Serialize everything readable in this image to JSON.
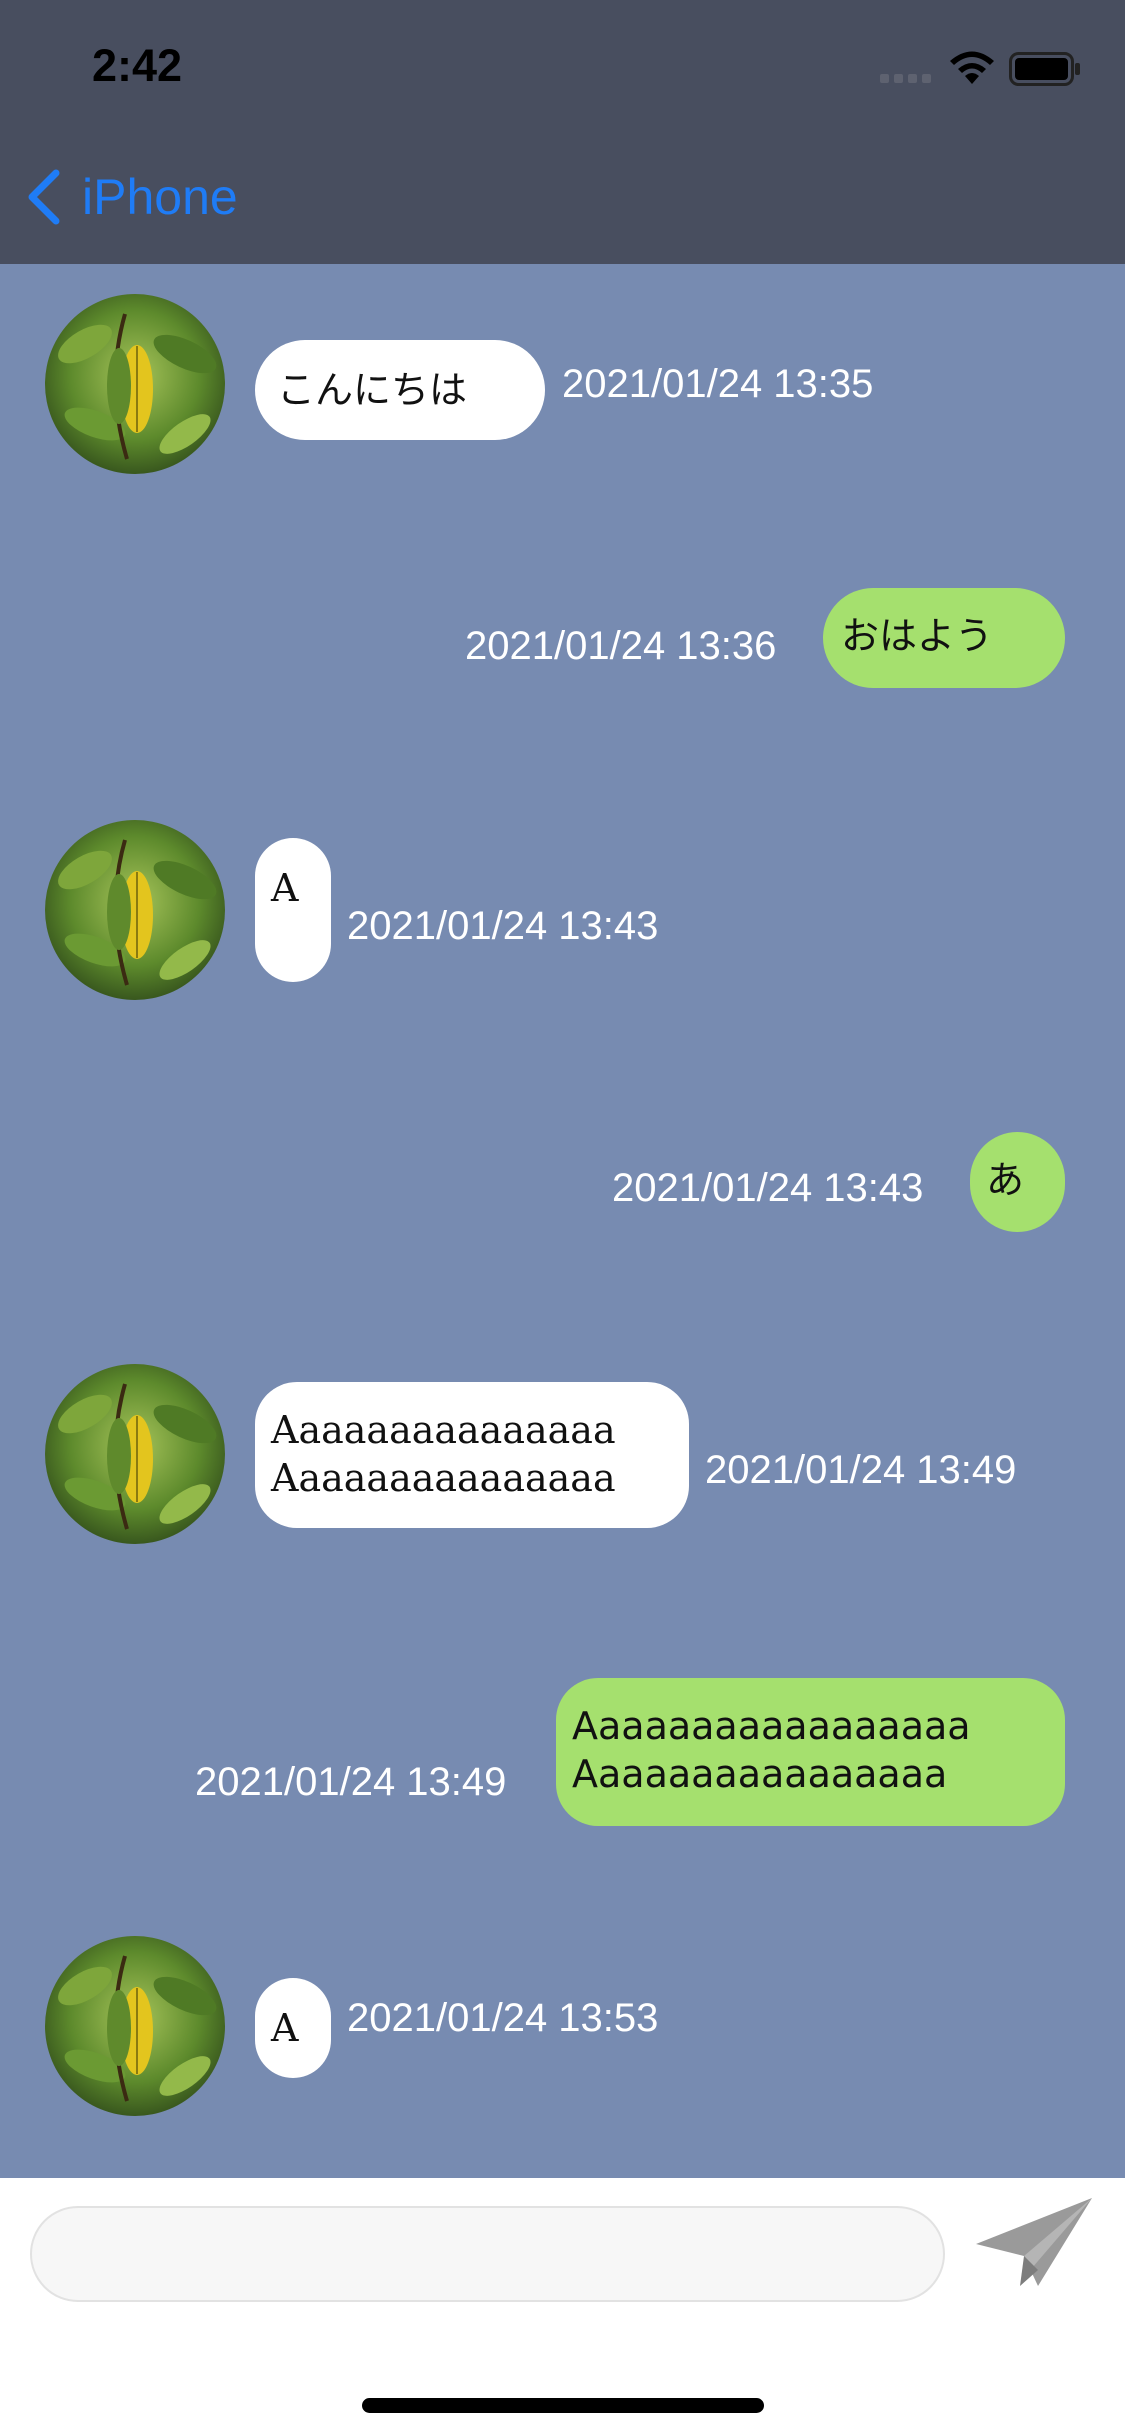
{
  "status_bar": {
    "time": "2:42",
    "icons": [
      "signal-icon",
      "wifi-icon",
      "battery-icon"
    ]
  },
  "nav": {
    "back_label": "iPhone",
    "back_icon": "chevron-left-icon"
  },
  "colors": {
    "bar_background": "#484e5f",
    "chat_background": "#778bb1",
    "incoming_bubble": "#ffffff",
    "outgoing_bubble": "#a5e06e",
    "accent": "#1f7cf6",
    "send_icon": "#9a9a9a"
  },
  "messages": [
    {
      "direction": "incoming",
      "lines": [
        "こんにちは"
      ],
      "time": "2021/01/24 13:35"
    },
    {
      "direction": "outgoing",
      "lines": [
        "おはよう"
      ],
      "time": "2021/01/24 13:36"
    },
    {
      "direction": "incoming",
      "lines": [
        "A"
      ],
      "time": "2021/01/24 13:43"
    },
    {
      "direction": "outgoing",
      "lines": [
        "あ"
      ],
      "time": "2021/01/24 13:43"
    },
    {
      "direction": "incoming",
      "lines": [
        "Aaaaaaaaaaaaaaa",
        "Aaaaaaaaaaaaaaa"
      ],
      "time": "2021/01/24 13:49"
    },
    {
      "direction": "outgoing",
      "lines": [
        "Aaaaaaaaaaaaaaaaa",
        "Aaaaaaaaaaaaaaaa"
      ],
      "time": "2021/01/24 13:49"
    },
    {
      "direction": "incoming",
      "lines": [
        "A"
      ],
      "time": "2021/01/24 13:53"
    }
  ],
  "composer": {
    "value": "",
    "placeholder": "",
    "send_icon": "paper-plane-icon"
  }
}
